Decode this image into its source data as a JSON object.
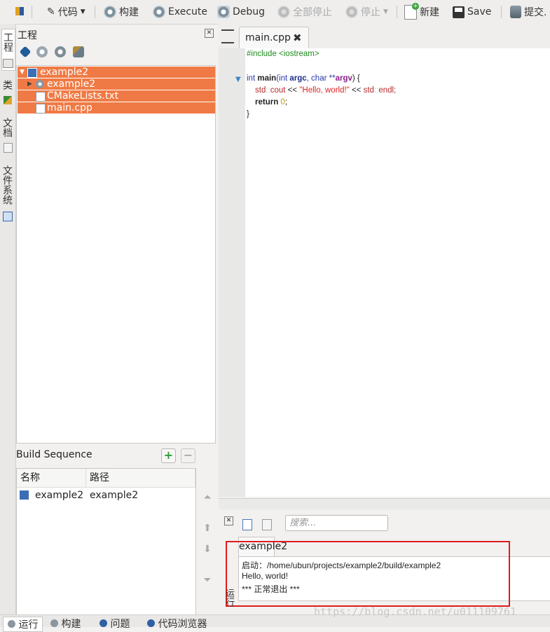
{
  "toolbar": {
    "code": "代码",
    "build": "构建",
    "execute": "Execute",
    "debug": "Debug",
    "stop_all": "全部停止",
    "stop": "停止",
    "new": "新建",
    "save": "Save",
    "commit": "提交."
  },
  "side_tabs": [
    "工程",
    "类",
    "文档",
    "文件系统"
  ],
  "project_panel": {
    "title": "工程",
    "close": "✕",
    "tree": [
      "example2",
      "example2",
      "CMakeLists.txt",
      "main.cpp"
    ]
  },
  "build_sequence": {
    "title": "Build Sequence",
    "add": "+",
    "remove": "−",
    "columns": [
      "名称",
      "路径"
    ],
    "rows": [
      {
        "name": "example2",
        "path": "example2"
      }
    ]
  },
  "editor": {
    "tab_title": "main.cpp",
    "tab_close": "✖",
    "code": {
      "include": "#include <iostream>",
      "sig_int": "int ",
      "sig_main": "main",
      "sig_args": "(int ",
      "sig_argc": "argc",
      "sig_mid": ", char **",
      "sig_argv": "argv",
      "sig_end": ") {",
      "cout_std": "std",
      "cout_sep": "::",
      "cout_kw": "cout",
      "cout_op": " << ",
      "cout_str": "\"Hello, world!\"",
      "cout_op2": " << ",
      "endl_std": "std",
      "endl_sep": "::",
      "endl_kw": "endl;",
      "ret_kw": "return ",
      "ret_val": "0",
      "ret_end": ";",
      "close": "}"
    }
  },
  "output": {
    "search_placeholder": "搜索...",
    "tab": "example2",
    "lines": [
      "启动：/home/ubun/projects/example2/build/example2",
      "Hello, world!",
      "*** 正常退出 ***"
    ],
    "vertical_tab": "运行"
  },
  "bottom_tabs": [
    "运行",
    "构建",
    "问题",
    "代码浏览器"
  ],
  "watermark": "https://blog.csdn.net/u011109761"
}
